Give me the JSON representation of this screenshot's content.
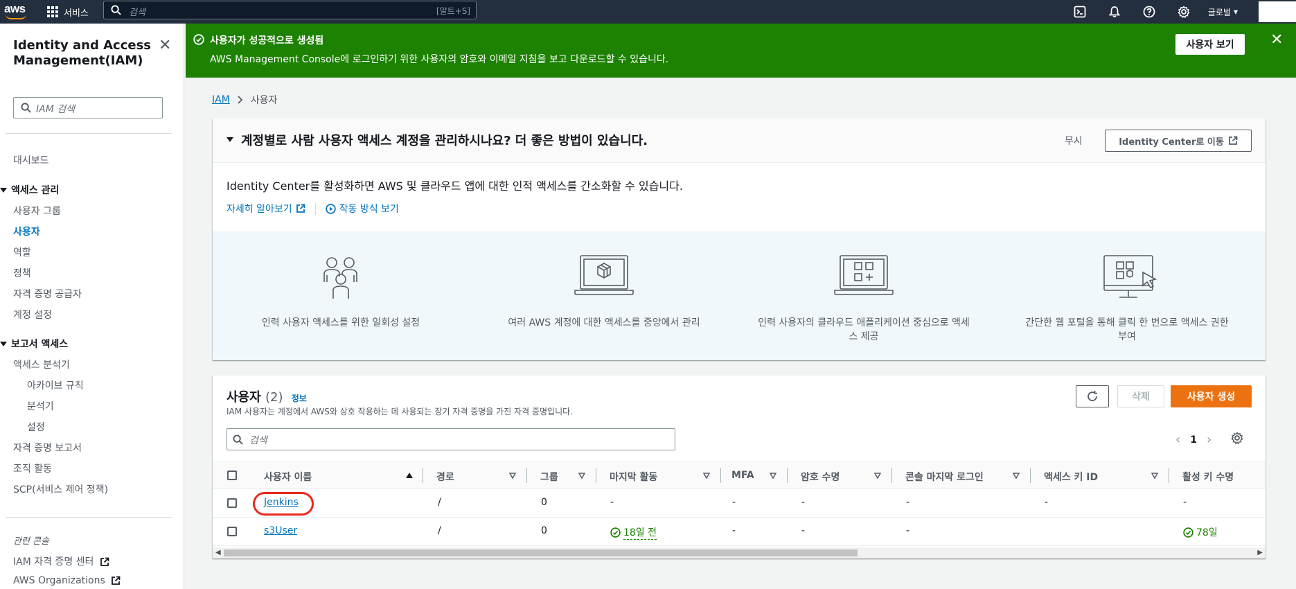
{
  "topnav": {
    "logo_text": "aws",
    "services_label": "서비스",
    "search_placeholder": "검색",
    "search_shortcut": "[알트+S]",
    "region_label": "글로벌"
  },
  "sidebar": {
    "title": "Identity and Access Management(IAM)",
    "search_placeholder": "IAM 검색",
    "dashboard": "대시보드",
    "access_mgmt_header": "액세스 관리",
    "access_items": [
      "사용자 그룹",
      "사용자",
      "역할",
      "정책",
      "자격 증명 공급자",
      "계정 설정"
    ],
    "active_item": "사용자",
    "reports_header": "보고서 액세스",
    "analyzer": "액세스 분석기",
    "analyzer_sub": [
      "아카이브 규칙",
      "분석기",
      "설정"
    ],
    "report_items": [
      "자격 증명 보고서",
      "조직 활동",
      "SCP(서비스 제어 정책)"
    ],
    "related_header": "관련 콘솔",
    "related_items": [
      "IAM 자격 증명 센터",
      "AWS Organizations"
    ]
  },
  "flash": {
    "title": "사용자가 성공적으로 생성됨",
    "desc": "AWS Management Console에 로그인하기 위한 사용자의 암호와 이메일 지침을 보고 다운로드할 수 있습니다.",
    "view_button": "사용자 보기",
    "color": "#1d8102"
  },
  "breadcrumb": {
    "root": "IAM",
    "current": "사용자"
  },
  "identity_center": {
    "title": "계정별로 사람 사용자 액세스 계정을 관리하시나요? 더 좋은 방법이 있습니다.",
    "ignore": "무시",
    "go_button": "Identity Center로 이동",
    "desc": "Identity Center를 활성화하면 AWS 및 클라우드 앱에 대한 인적 액세스를 간소화할 수 있습니다.",
    "learn_more": "자세히 알아보기",
    "how_it_works": "작동 방식 보기",
    "features": [
      {
        "icon": "people-icon",
        "label": "인력 사용자 액세스를 위한 일회성 설정"
      },
      {
        "icon": "laptop-cube-icon",
        "label": "여러 AWS 계정에 대한 액세스를 중앙에서 관리"
      },
      {
        "icon": "laptop-apps-icon",
        "label": "인력 사용자의 클라우드 애플리케이션 중심으로 액세스 제공"
      },
      {
        "icon": "monitor-cursor-icon",
        "label": "간단한 웹 포털을 통해 클릭 한 번으로 액세스 권한 부여"
      }
    ]
  },
  "users": {
    "title": "사용자",
    "count": "(2)",
    "info": "정보",
    "desc": "IAM 사용자는 계정에서 AWS와 상호 작용하는 데 사용되는 장기 자격 증명을 가진 자격 증명입니다.",
    "delete_button": "삭제",
    "create_button": "사용자 생성",
    "search_placeholder": "검색",
    "page": "1",
    "columns": [
      "사용자 이름",
      "경로",
      "그룹",
      "마지막 활동",
      "MFA",
      "암호 수명",
      "콘솔 마지막 로그인",
      "액세스 키 ID",
      "활성 키 수명"
    ],
    "rows": [
      {
        "name": "Jenkins",
        "path": "/",
        "groups": "0",
        "last_activity": "-",
        "mfa": "-",
        "pw_age": "-",
        "console_login": "-",
        "key_id": "-",
        "key_age": "-"
      },
      {
        "name": "s3User",
        "path": "/",
        "groups": "0",
        "last_activity": "18일 전",
        "mfa": "-",
        "pw_age": "-",
        "console_login": "-",
        "key_id": "",
        "key_age": "78일"
      }
    ],
    "accent": "#ec7211"
  }
}
